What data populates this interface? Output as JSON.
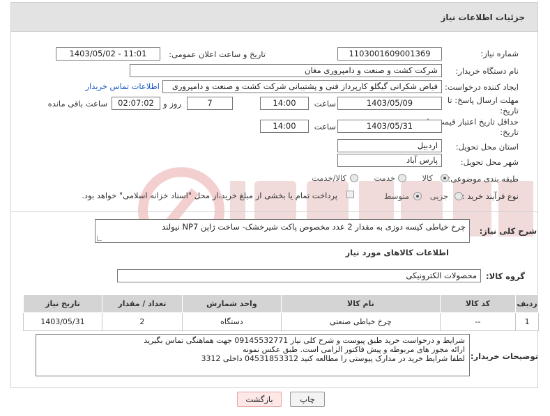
{
  "header": {
    "title": "جزئیات اطلاعات نیاز"
  },
  "fields": {
    "need_number_label": "شماره نیاز:",
    "need_number": "1103001609001369",
    "announce_label": "تاریخ و ساعت اعلان عمومی:",
    "announce_value": "1403/05/02 - 11:01",
    "buyer_label": "نام دستگاه خریدار:",
    "buyer": "شرکت کشت و صنعت و دامپروری مغان",
    "creator_label": "ایجاد کننده درخواست:",
    "creator": "فیاض شکرانی گیگلو کارپرداز فنی و پشتیبانی شرکت کشت و صنعت و دامپروری",
    "contact_link": "اطلاعات تماس خریدار",
    "deadline_label": "مهلت ارسال پاسخ: تا تاریخ:",
    "deadline_date": "1403/05/09",
    "time_label": "ساعت",
    "deadline_time": "14:00",
    "days_value": "7",
    "days_label": "روز و",
    "remaining_value": "02:07:02",
    "remaining_label": "ساعت باقی مانده",
    "validity_label": "حداقل تاریخ اعتبار قیمت: تا تاریخ:",
    "validity_date": "1403/05/31",
    "validity_time": "14:00",
    "province_label": "استان محل تحویل:",
    "province": "اردبیل",
    "city_label": "شهر محل تحویل:",
    "city": "پارس آباد",
    "category_label": "طبقه بندی موضوعی:",
    "category_options": [
      "کالا",
      "خدمت",
      "کالا/خدمت"
    ],
    "process_label": "نوع فرآیند خرید :",
    "process_options": [
      "جزیی",
      "متوسط"
    ],
    "payment_note": "پرداخت تمام یا بخشی از مبلغ خرید،از محل \"اسناد خزانه اسلامی\" خواهد بود.",
    "summary_label": "شرح کلی نیاز:",
    "summary": "چرخ خیاطی کیسه دوزی به مقدار 2 عدد مخصوص پاکت شیرخشک- ساخت ژاپن NP7 نیولند",
    "items_info_title": "اطلاعات کالاهای مورد نیاز",
    "group_label": "گروه کالا:",
    "group": "محصولات الکترونیکی"
  },
  "table": {
    "headers": [
      "ردیف",
      "کد کالا",
      "نام کالا",
      "واحد شمارش",
      "تعداد / مقدار",
      "تاریخ نیاز"
    ],
    "rows": [
      [
        "1",
        "--",
        "چرخ خیاطی صنعتی",
        "دستگاه",
        "2",
        "1403/05/31"
      ]
    ]
  },
  "notes": {
    "label": "توضیحات خریدار:",
    "lines": [
      "شرایط و درخواست خرید طبق پیوست و شرح کلی نیاز 09145532771 جهت هماهنگی تماس بگیرید",
      "ارائه مجوز های مربوطه و پیش فاکتور الزامی است. طبق عکس نمونه",
      "لطفا شرایط خرید در مدارک پیوستی را مطالعه کنید        04531853312     داخلی  3312"
    ]
  },
  "buttons": {
    "print": "چاپ",
    "back": "بازگشت"
  }
}
